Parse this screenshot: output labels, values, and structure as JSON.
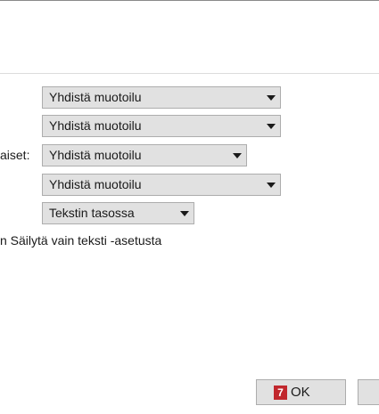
{
  "dialog": {
    "rows": [
      {
        "label": "",
        "value": "Yhdistä muotoilu"
      },
      {
        "label": "",
        "value": "Yhdistä muotoilu"
      },
      {
        "label": "aiset:",
        "value": "Yhdistä muotoilu"
      },
      {
        "label": "",
        "value": "Yhdistä muotoilu"
      },
      {
        "label": "",
        "value": "Tekstin tasossa"
      }
    ],
    "note": "n Säilytä vain teksti -asetusta"
  },
  "buttons": {
    "ok_badge": "7",
    "ok_label": "OK"
  },
  "colors": {
    "badge": "#c1272d",
    "control_bg": "#e1e1e1",
    "control_border": "#adadad"
  }
}
